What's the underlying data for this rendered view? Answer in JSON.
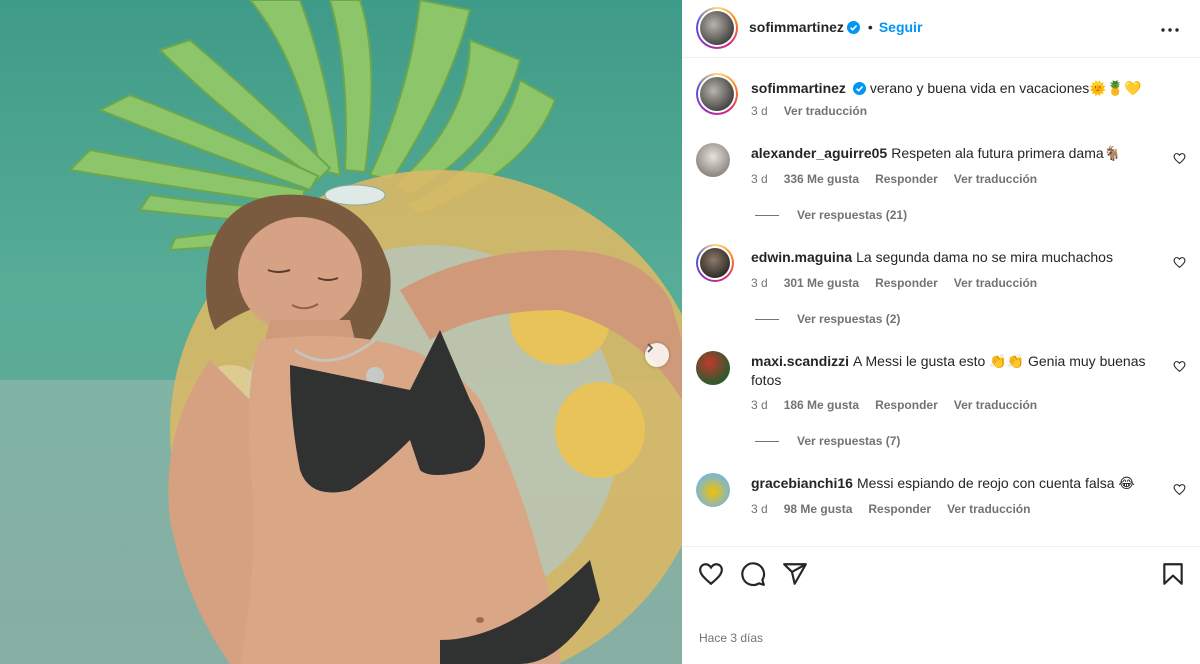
{
  "post": {
    "author": "sofimmartinez",
    "follow_label": "Seguir",
    "separator": "•",
    "caption": "verano y buena vida en vacaciones🌞🍍💛",
    "caption_time": "3 d",
    "translate_label": "Ver traducción",
    "time_ago": "Hace 3 días"
  },
  "comments": [
    {
      "username": "alexander_aguirre05",
      "text": "Respeten ala futura primera dama🐐",
      "time": "3 d",
      "likes": "336 Me gusta",
      "reply_label": "Responder",
      "translate_label": "Ver traducción",
      "replies_label": "Ver respuestas (21)"
    },
    {
      "username": "edwin.maguina",
      "text": "La segunda dama no se mira muchachos",
      "time": "3 d",
      "likes": "301 Me gusta",
      "reply_label": "Responder",
      "translate_label": "Ver traducción",
      "replies_label": "Ver respuestas (2)"
    },
    {
      "username": "maxi.scandizzi",
      "text": "A Messi le gusta esto 👏👏 Genia muy buenas fotos",
      "time": "3 d",
      "likes": "186 Me gusta",
      "reply_label": "Responder",
      "translate_label": "Ver traducción",
      "replies_label": "Ver respuestas (7)"
    },
    {
      "username": "gracebianchi16",
      "text": "Messi espiando de reojo con cuenta falsa 😂",
      "time": "3 d",
      "likes": "98 Me gusta",
      "reply_label": "Responder",
      "translate_label": "Ver traducción"
    }
  ],
  "colors": {
    "accent": "#0095f6",
    "text": "#262626",
    "secondary": "#737373",
    "border": "#efefef"
  },
  "icons": [
    "verified-badge-icon",
    "more-options-icon",
    "heart-icon",
    "comment-icon",
    "share-icon",
    "bookmark-icon",
    "chevron-right-icon"
  ]
}
